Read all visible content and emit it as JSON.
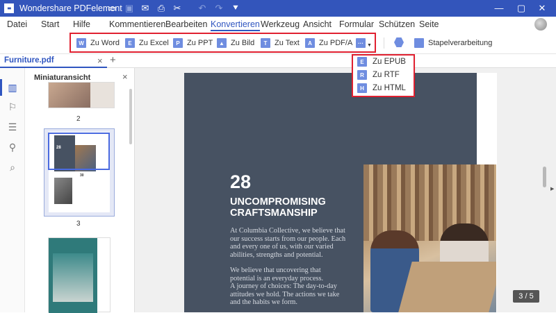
{
  "app": {
    "title": "Wondershare PDFelement"
  },
  "menu": {
    "items": [
      "Datei",
      "Start",
      "Hilfe",
      "Kommentieren",
      "Bearbeiten",
      "Konvertieren",
      "Werkzeug",
      "Ansicht",
      "Formular",
      "Schützen",
      "Seite"
    ],
    "active": "Konvertieren"
  },
  "toolbar": {
    "word": "Zu Word",
    "excel": "Zu Excel",
    "ppt": "Zu PPT",
    "bild": "Zu Bild",
    "text": "Zu Text",
    "pdfa": "Zu PDF/A",
    "batch": "Stapelverarbeitung",
    "more": "···"
  },
  "dropdown": {
    "items": [
      {
        "icon": "E",
        "label": "Zu EPUB"
      },
      {
        "icon": "R",
        "label": "Zu RTF"
      },
      {
        "icon": "H",
        "label": "Zu HTML"
      }
    ]
  },
  "tab": {
    "name": "Furniture.pdf",
    "close": "×",
    "add": "+"
  },
  "thumbnails": {
    "title": "Miniaturansicht",
    "close": "×",
    "pages": [
      "2",
      "3"
    ],
    "mini_number": "28",
    "mini_number2": "30"
  },
  "page_content": {
    "number": "28",
    "heading_line1": "UNCOMPROMISING",
    "heading_line2": "CRAFTSMANSHIP",
    "para1": [
      "At Columbia Collective, we believe that",
      "our success starts from our people. Each",
      "and every one of us, with our varied",
      "abilities, strengths and potential."
    ],
    "para2": [
      "We believe that uncovering that",
      "potential is an everyday process.",
      "A journey of choices: The day-to-day",
      "attitudes we hold. The actions we take",
      "and the habits we form."
    ]
  },
  "page_indicator": "3 / 5",
  "colors": {
    "titlebar": "#3355bb",
    "accent": "#2f55c0",
    "highlight": "#e02030",
    "dark_page": "#475262"
  }
}
